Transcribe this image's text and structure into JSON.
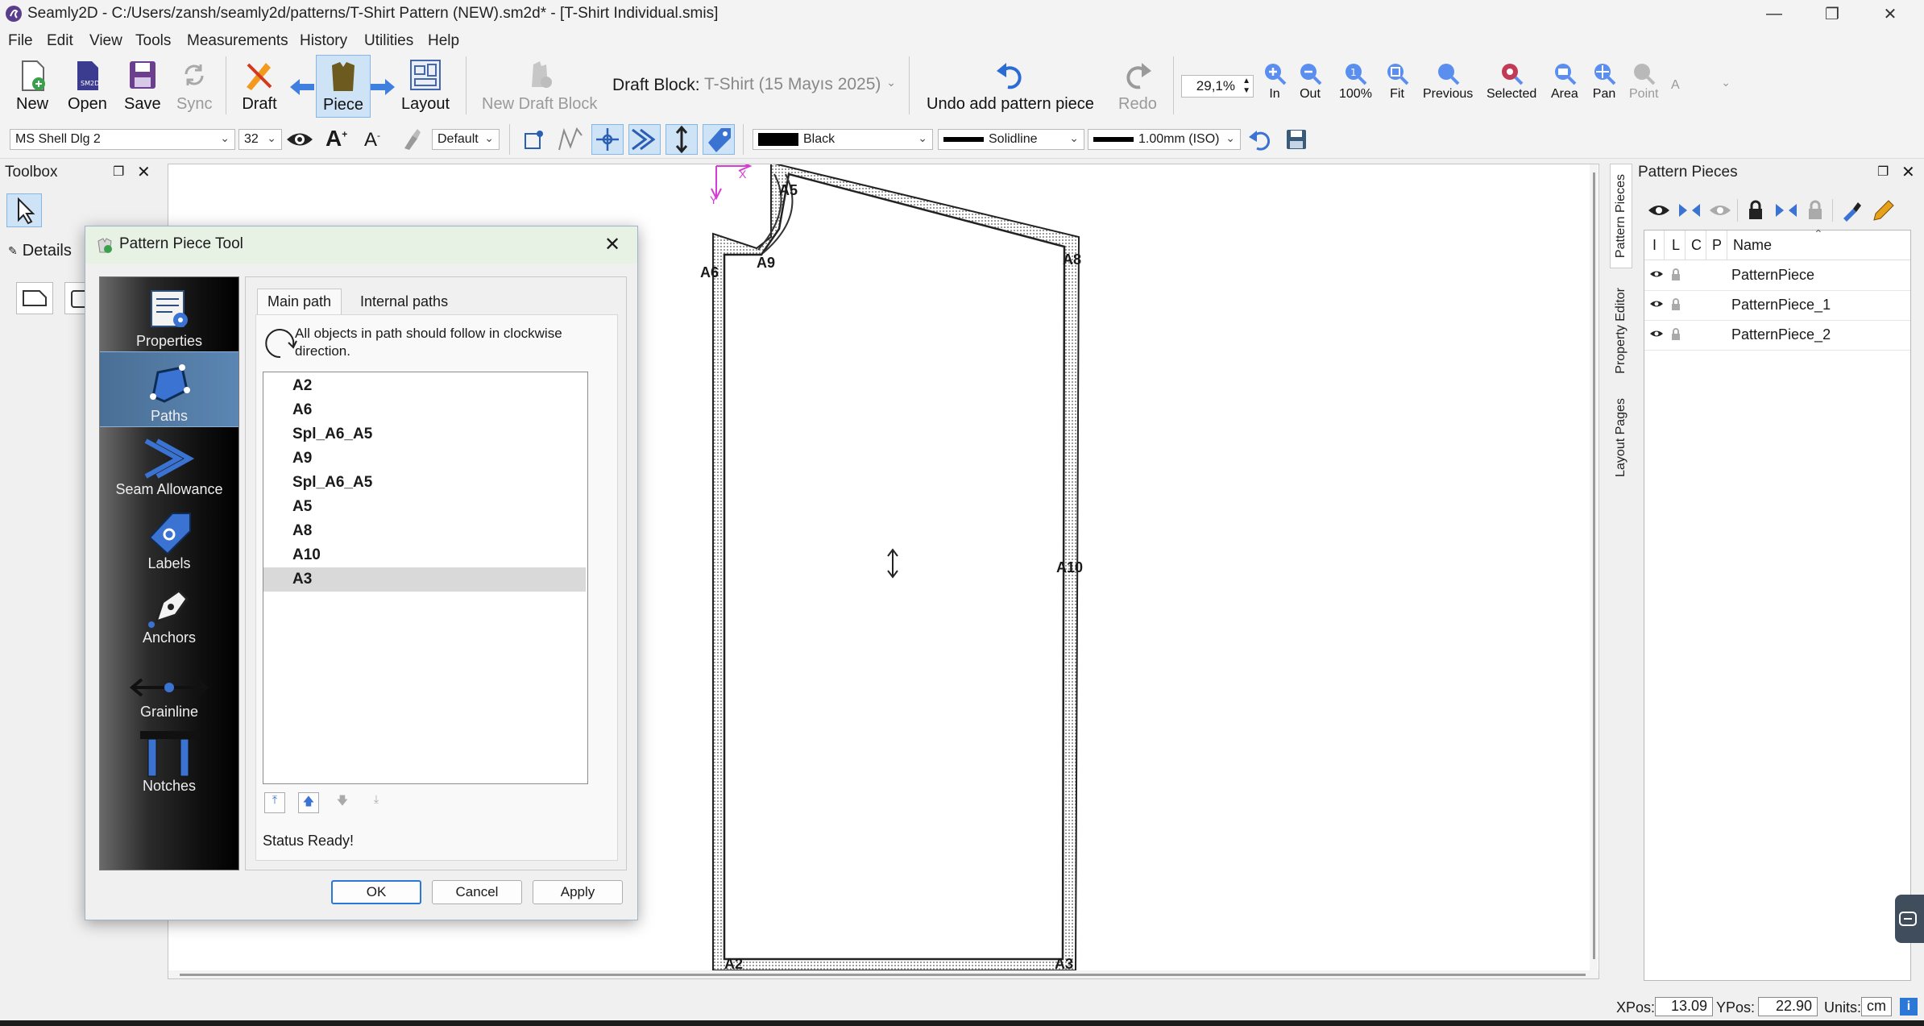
{
  "window": {
    "title": "Seamly2D - C:/Users/zansh/seamly2d/patterns/T-Shirt Pattern (NEW).sm2d* - [T-Shirt Individual.smis]"
  },
  "menu": [
    "File",
    "Edit",
    "View",
    "Tools",
    "Measurements",
    "History",
    "Utilities",
    "Help"
  ],
  "toolbar": {
    "new": "New",
    "open": "Open",
    "save": "Save",
    "sync": "Sync",
    "draft": "Draft",
    "piece": "Piece",
    "layout": "Layout",
    "new_draft_block": "New Draft Block",
    "draft_block_label": "Draft Block:",
    "draft_block_value": "T-Shirt (15 Mayıs 2025)",
    "undo": "Undo add pattern piece",
    "redo": "Redo",
    "zoom_value": "29,1%",
    "zoom_in": "In",
    "zoom_out": "Out",
    "zoom_100": "100%",
    "zoom_fit": "Fit",
    "zoom_previous": "Previous",
    "zoom_selected": "Selected",
    "zoom_area": "Area",
    "pan": "Pan",
    "point": "Point",
    "point_combo": "A"
  },
  "toolbar2": {
    "font": "MS Shell Dlg 2",
    "font_size": "32",
    "label_mode": "Default",
    "color": "Black",
    "line_type": "Solidline",
    "line_weight": "1.00mm (ISO)",
    "color_hex": "#000000"
  },
  "toolbox": {
    "title": "Toolbox",
    "details_tab": "Details"
  },
  "dialog": {
    "title": "Pattern Piece Tool",
    "sidebar": [
      "Properties",
      "Paths",
      "Seam Allowance",
      "Labels",
      "Anchors",
      "Grainline",
      "Notches"
    ],
    "selected_sidebar": "Paths",
    "tabs": [
      "Main path",
      "Internal paths"
    ],
    "hint": "All objects in path should follow in clockwise direction.",
    "path_items": [
      "A2",
      "A6",
      "Spl_A6_A5",
      "A9",
      "Spl_A6_A5",
      "A5",
      "A8",
      "A10",
      "A3"
    ],
    "selected_item": "A3",
    "status": "Status Ready!",
    "ok": "OK",
    "cancel": "Cancel",
    "apply": "Apply"
  },
  "canvas": {
    "points": [
      "A5",
      "A6",
      "A9",
      "A8",
      "A10",
      "A2",
      "A3"
    ],
    "axis_x": "X",
    "axis_y": "Y"
  },
  "pattern_pieces": {
    "title": "Pattern Pieces",
    "columns": [
      "I",
      "L",
      "C",
      "P",
      "Name"
    ],
    "rows": [
      "PatternPiece",
      "PatternPiece_1",
      "PatternPiece_2"
    ]
  },
  "right_tabs": [
    "Pattern Pieces",
    "Property Editor",
    "Layout Pages"
  ],
  "status": {
    "xpos_label": "XPos:",
    "xpos": "13.09",
    "ypos_label": "YPos:",
    "ypos": "22.90",
    "units_label": "Units:",
    "units": "cm"
  },
  "colors": {
    "accent": "#2b78d6",
    "piece_active": "#cfe3f7",
    "logo": "#5a3d8c"
  }
}
